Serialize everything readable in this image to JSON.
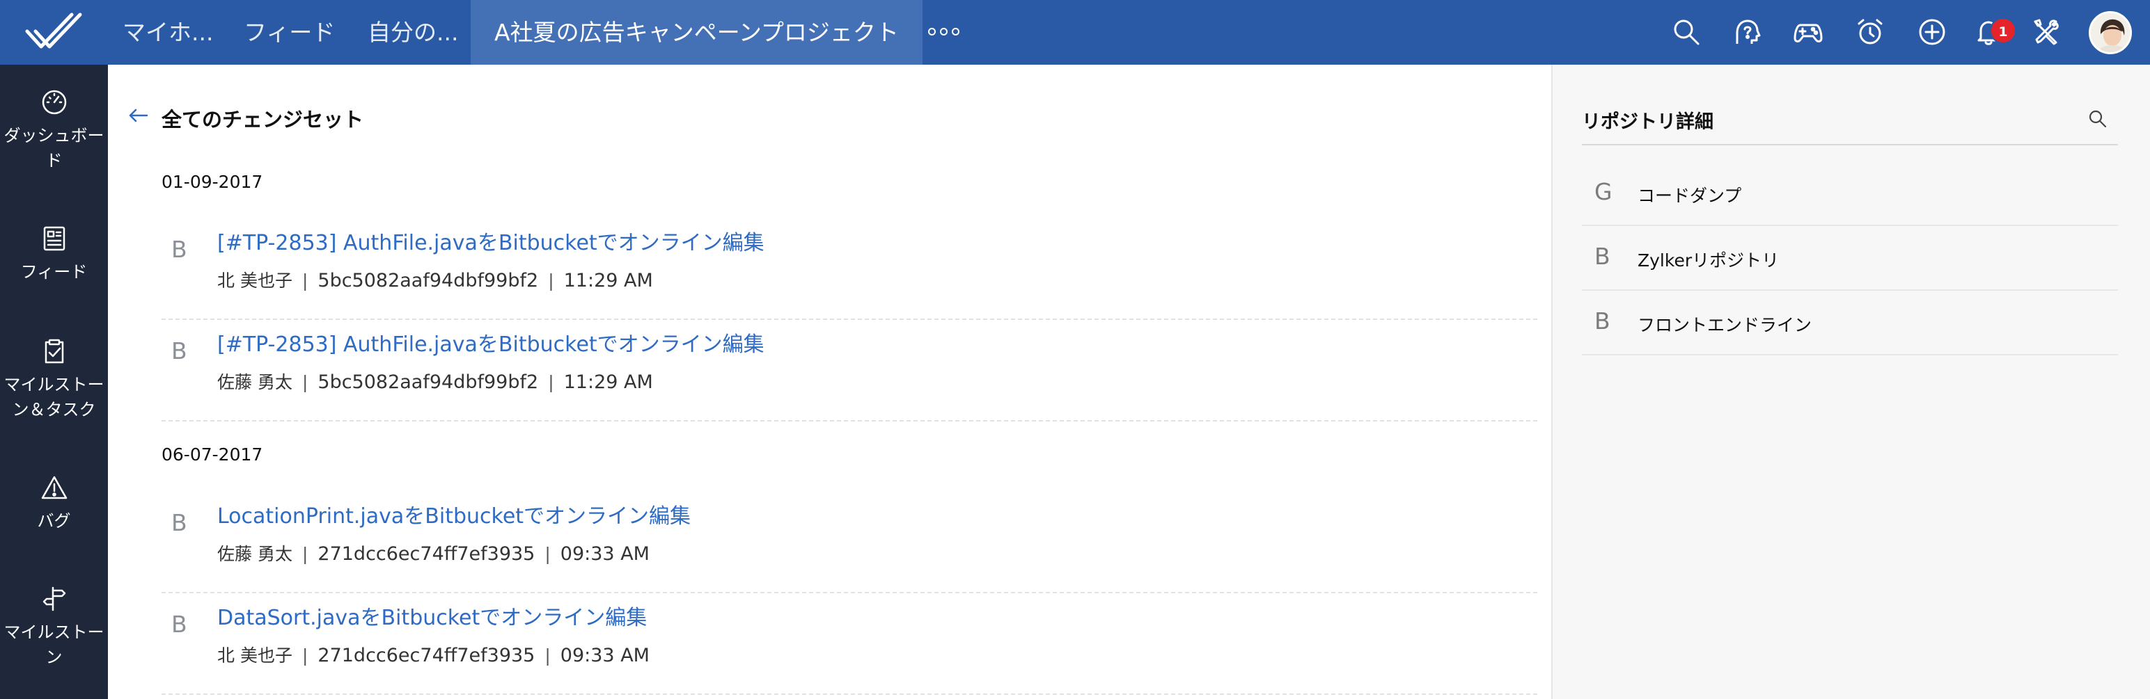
{
  "topbar": {
    "tabs": [
      "マイホ...",
      "フィード",
      "自分の...",
      "A社夏の広告キャンペーンプロジェクト"
    ],
    "notification_count": "1",
    "icons": [
      "search-icon",
      "help-icon",
      "gamepad-icon",
      "alarm-icon",
      "add-icon",
      "bell-icon",
      "tools-icon"
    ]
  },
  "sidebar": {
    "items": [
      {
        "label": "ダッシュボード",
        "icon": "dashboard-icon"
      },
      {
        "label": "フィード",
        "icon": "feed-icon"
      },
      {
        "label": "マイルストーン＆タスク",
        "icon": "tasks-icon"
      },
      {
        "label": "バグ",
        "icon": "bug-warning-icon"
      },
      {
        "label": "マイルストーン",
        "icon": "milestone-signpost-icon"
      }
    ]
  },
  "main": {
    "title": "全てのチェンジセット",
    "groups": [
      {
        "date": "01-09-2017",
        "changesets": [
          {
            "letter": "B",
            "title": "[#TP-2853] AuthFile.javaをBitbucketでオンライン編集",
            "author": "北 美也子",
            "hash": "5bc5082aaf94dbf99bf2",
            "time": "11:29 AM"
          },
          {
            "letter": "B",
            "title": "[#TP-2853] AuthFile.javaをBitbucketでオンライン編集",
            "author": "佐藤 勇太",
            "hash": "5bc5082aaf94dbf99bf2",
            "time": "11:29 AM"
          }
        ]
      },
      {
        "date": "06-07-2017",
        "changesets": [
          {
            "letter": "B",
            "title": "LocationPrint.javaをBitbucketでオンライン編集",
            "author": "佐藤 勇太",
            "hash": "271dcc6ec74ff7ef3935",
            "time": "09:33 AM"
          },
          {
            "letter": "B",
            "title": "DataSort.javaをBitbucketでオンライン編集",
            "author": "北 美也子",
            "hash": "271dcc6ec74ff7ef3935",
            "time": "09:33 AM"
          }
        ]
      }
    ]
  },
  "right_panel": {
    "title": "リポジトリ詳細",
    "repos": [
      {
        "letter": "G",
        "name": "コードダンプ"
      },
      {
        "letter": "B",
        "name": "Zylkerリポジトリ"
      },
      {
        "letter": "B",
        "name": "フロントエンドライン"
      }
    ]
  },
  "colors": {
    "topbar": "#2a5aa5",
    "active_tab": "#4471b6",
    "sidebar": "#1e283a",
    "link": "#2e6bc4",
    "badge": "#e4242a"
  }
}
